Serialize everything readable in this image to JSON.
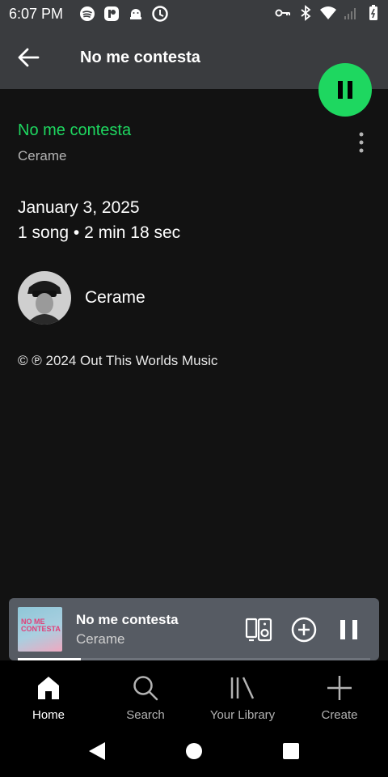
{
  "status_bar": {
    "time": "6:07 PM",
    "left_icons": [
      "spotify-icon",
      "app-icon",
      "android-icon",
      "vpn-icon"
    ],
    "right_icons": [
      "key-icon",
      "bluetooth-icon",
      "wifi-icon",
      "signal-icon",
      "battery-icon"
    ]
  },
  "header": {
    "title": "No me contesta",
    "back_icon": "arrow-left-icon"
  },
  "track": {
    "title": "No me contesta",
    "artist": "Cerame"
  },
  "release": {
    "date": "January 3, 2025",
    "info": "1 song • 2 min 18 sec"
  },
  "artist": {
    "name": "Cerame"
  },
  "copyright": "© ℗ 2024 Out This Worlds Music",
  "mini_player": {
    "title": "No me contesta",
    "artist": "Cerame",
    "art_text": "NO ME CONTESTA",
    "progress": 0.18
  },
  "nav": {
    "items": [
      {
        "label": "Home",
        "icon": "home-icon",
        "active": true
      },
      {
        "label": "Search",
        "icon": "search-icon",
        "active": false
      },
      {
        "label": "Your Library",
        "icon": "library-icon",
        "active": false
      },
      {
        "label": "Create",
        "icon": "plus-icon",
        "active": false
      }
    ]
  },
  "colors": {
    "accent": "#1ed760",
    "background": "#121212",
    "header": "#3a3c3f",
    "mini_player": "#565b63"
  }
}
